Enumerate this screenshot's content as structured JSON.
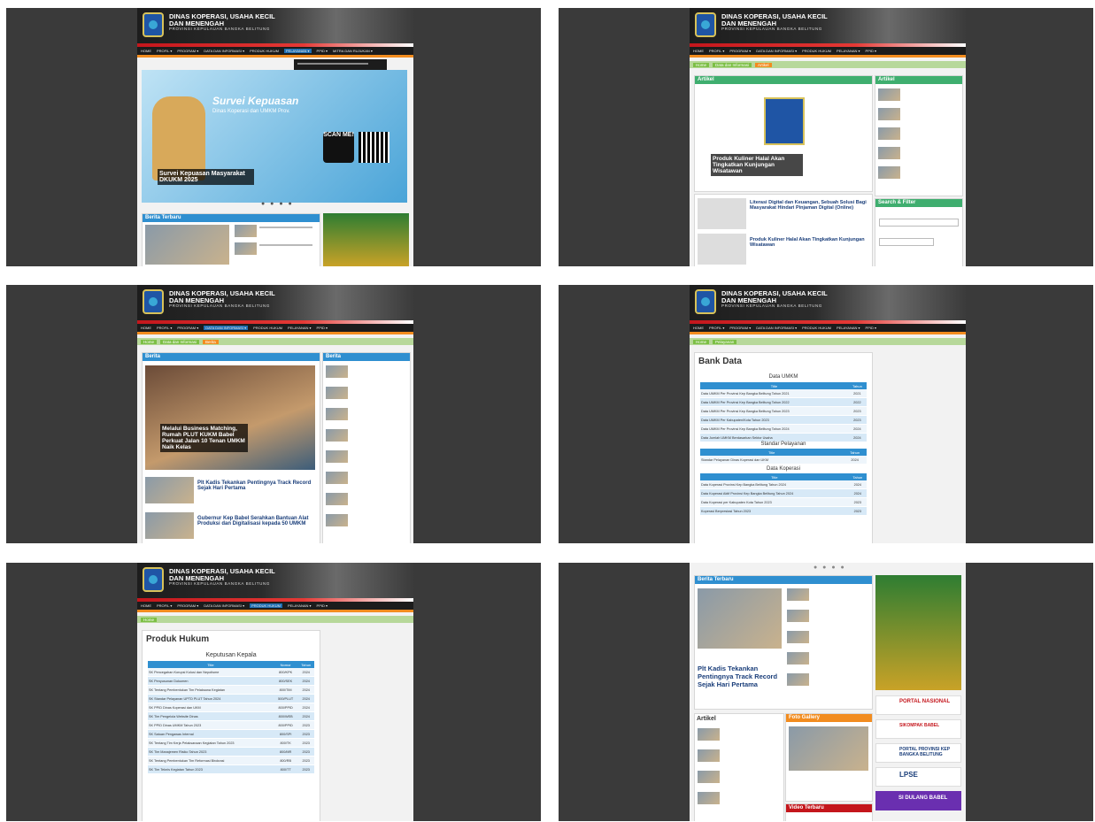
{
  "header": {
    "line1": "DINAS KOPERASI, USAHA KECIL",
    "line2": "DAN MENENGAH",
    "subtitle": "PROVINSI KEPULAUAN BANGKA BELITUNG"
  },
  "nav": {
    "items": [
      "HOME",
      "PROFIL ▾",
      "PROGRAM ▾",
      "DATA DAN INFORMASI ▾",
      "PRODUK HUKUM",
      "PELAYANAN ▾",
      "PPID ▾",
      "MITRA DAN RUJUKAN ▾"
    ]
  },
  "tile1": {
    "banner_title": "Survei Kepuasan",
    "banner_sub": "Dinas Koperasi dan UMKM Prov.",
    "scan": "SCAN ME!",
    "caption": "Survei Kepuasan Masyarakat DKUKM 2025",
    "section": "Berita Terbaru",
    "dots": "● ● ● ●"
  },
  "tile2": {
    "crumbs": [
      "Home",
      "Data dan Informasi",
      "Artikel"
    ],
    "artikel": "Artikel",
    "caption": "Produk Kuliner Halal Akan Tingkatkan Kunjungan Wisatawan",
    "list_title1": "Literasi Digital dan Keuangan, Sebuah Solusi Bagi Masyarakat Hindari Pinjaman Digital (Online)",
    "list_title2": "Produk Kuliner Halal Akan Tingkatkan Kunjungan Wisatawan",
    "side_title": "Artikel",
    "search_title": "Search & Filter"
  },
  "tile3": {
    "crumbs": [
      "Home",
      "Data dan Informasi",
      "Berita"
    ],
    "section": "Berita",
    "caption": "Melalui Business Matching, Rumah PLUT KUKM Babel Perkuat Jalan 10 Tenan UMKM Naik Kelas",
    "news1": "Plt Kadis Tekankan Pentingnya Track Record Sejak Hari Pertama",
    "news2": "Gubernur Kep Babel Serahkan Bantuan Alat Produksi dan Digitalisasi kepada 50 UMKM",
    "side": "Berita"
  },
  "tile4": {
    "crumbs": [
      "Home",
      "Pelayanan"
    ],
    "title": "Bank Data",
    "sec1": "Data UMKM",
    "sec2": "Standar Pelayanan",
    "sec3": "Data Koperasi",
    "col1": "Title",
    "col2": "Tahun",
    "rows1": [
      [
        "Data UMKM Per Provinsi Kep Bangka Belitung Tahun 2021",
        "2021"
      ],
      [
        "Data UMKM Per Provinsi Kep Bangka Belitung Tahun 2022",
        "2022"
      ],
      [
        "Data UMKM Per Provinsi Kep Bangka Belitung Tahun 2023",
        "2023"
      ],
      [
        "Data UMKM Per Kabupaten/Kota Tahun 2023",
        "2023"
      ],
      [
        "Data UMKM Per Provinsi Kep Bangka Belitung Tahun 2024",
        "2024"
      ],
      [
        "Data Jumlah UMKM Berdasarkan Sektor Usaha",
        "2024"
      ]
    ],
    "rows2": [
      [
        "Standar Pelayanan Dinas Koperasi dan UKM",
        "2024"
      ]
    ],
    "rows3": [
      [
        "Data Koperasi Provinsi Kep Bangka Belitung Tahun 2024",
        "2024"
      ],
      [
        "Data Koperasi Aktif Provinsi Kep Bangka Belitung Tahun 2024",
        "2024"
      ],
      [
        "Data Koperasi per Kabupaten Kota Tahun 2023",
        "2023"
      ],
      [
        "Koperasi Berprestasi Tahun 2023",
        "2023"
      ]
    ]
  },
  "tile5": {
    "crumbs": [
      "Home"
    ],
    "title": "Produk Hukum",
    "sec1": "Keputusan Kepala",
    "col1": "Title",
    "col2": "Nomor",
    "col3": "Tahun",
    "rows": [
      [
        "SK Pencegahan Korupsi Kolusi dan Nepotisme",
        "800/KPK",
        "2024"
      ],
      [
        "SK Penyusunan Dokumen",
        "800/SEK",
        "2024"
      ],
      [
        "SK Tentang Pembentukan Tim Pelaksana Kegiatan",
        "800/TIM",
        "2024"
      ],
      [
        "SK Standar Pelayanan UPTD PLUT Tahun 2024",
        "500/PLUT",
        "2024"
      ],
      [
        "SK PPID Dinas Koperasi dan UKM",
        "800/PPID",
        "2024"
      ],
      [
        "SK Tim Pengelola Website Dinas",
        "800/WEB",
        "2024"
      ],
      [
        "SK PPID Dinas UMKM Tahun 2023",
        "800/PPID",
        "2023"
      ],
      [
        "SK Satuan Pengawas Internal",
        "800/SPI",
        "2023"
      ],
      [
        "SK Tentang Tim Kerja Pelaksanaan Kegiatan Tahun 2023",
        "800/TK",
        "2023"
      ],
      [
        "SK Tim Manajemen Risiko Tahun 2023",
        "800/MR",
        "2023"
      ],
      [
        "SK Tentang Pembentukan Tim Reformasi Birokrasi",
        "800/RB",
        "2023"
      ],
      [
        "SK Tim Teknis Kegiatan Tahun 2023",
        "800/TT",
        "2023"
      ]
    ]
  },
  "tile6": {
    "section": "Berita Terbaru",
    "news_title": "Plt Kadis Tekankan Pentingnya Track Record Sejak Hari Pertama",
    "artikel": "Artikel",
    "foto": "Foto Gallery",
    "video": "Video Terbaru",
    "banners": [
      "PORTAL NASIONAL",
      "SIKOMPAK BABEL",
      "PORTAL PROVINSI KEP BANGKA BELITUNG",
      "LPSE",
      "SI DULANG BABEL"
    ],
    "dots": "● ● ● ●"
  }
}
